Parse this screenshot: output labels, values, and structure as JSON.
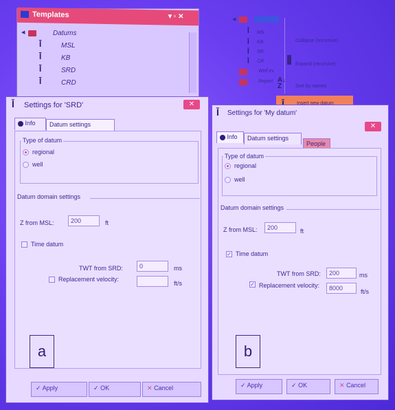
{
  "templates_panel": {
    "title": "Templates",
    "title_controls": "▾ ▫ ✕",
    "root": "Datums",
    "items": [
      "MSL",
      "KB",
      "SRD",
      "CRD"
    ]
  },
  "context_menu": {
    "tree_items": [
      "MS",
      "KB",
      "SR",
      "CR",
      "Well ev",
      "Report"
    ],
    "collapse": "Collapse (recursive)",
    "expand": "Expand (recursive)",
    "sort": "Sort by names",
    "insert": "Insert new datum"
  },
  "dialog_a": {
    "title": "Settings for 'SRD'",
    "tabs": [
      "Info",
      "Datum settings"
    ],
    "type_group": "Type of datum",
    "type_options": [
      "regional",
      "well"
    ],
    "domain_group": "Datum domain settings",
    "z_label": "Z from MSL:",
    "z_value": "200",
    "z_unit": "ft",
    "time_datum": "Time datum",
    "twt_label": "TWT from SRD:",
    "twt_value": "0",
    "twt_unit": "ms",
    "repl_label": "Replacement velocity:",
    "repl_value": "",
    "repl_unit": "ft/s",
    "annotation": "a",
    "apply": "Apply",
    "ok": "OK",
    "cancel": "Cancel"
  },
  "dialog_b": {
    "title": "Settings for 'My datum'",
    "tabs": [
      "Info",
      "Datum settings",
      "People"
    ],
    "type_group": "Type of datum",
    "type_options": [
      "regional",
      "well"
    ],
    "domain_group": "Datum domain settings",
    "z_label": "Z from MSL:",
    "z_value": "200",
    "z_unit": "ft",
    "time_datum": "Time datum",
    "twt_label": "TWT from SRD:",
    "twt_value": "200",
    "twt_unit": "ms",
    "repl_label": "Replacement velocity:",
    "repl_value": "8000",
    "repl_unit": "ft/s",
    "annotation": "b",
    "apply": "Apply",
    "ok": "OK",
    "cancel": "Cancel"
  },
  "icons": [
    "close-icon",
    "info-icon",
    "datum-icon",
    "folder-icon",
    "sort-icon",
    "checkmark-icon"
  ]
}
